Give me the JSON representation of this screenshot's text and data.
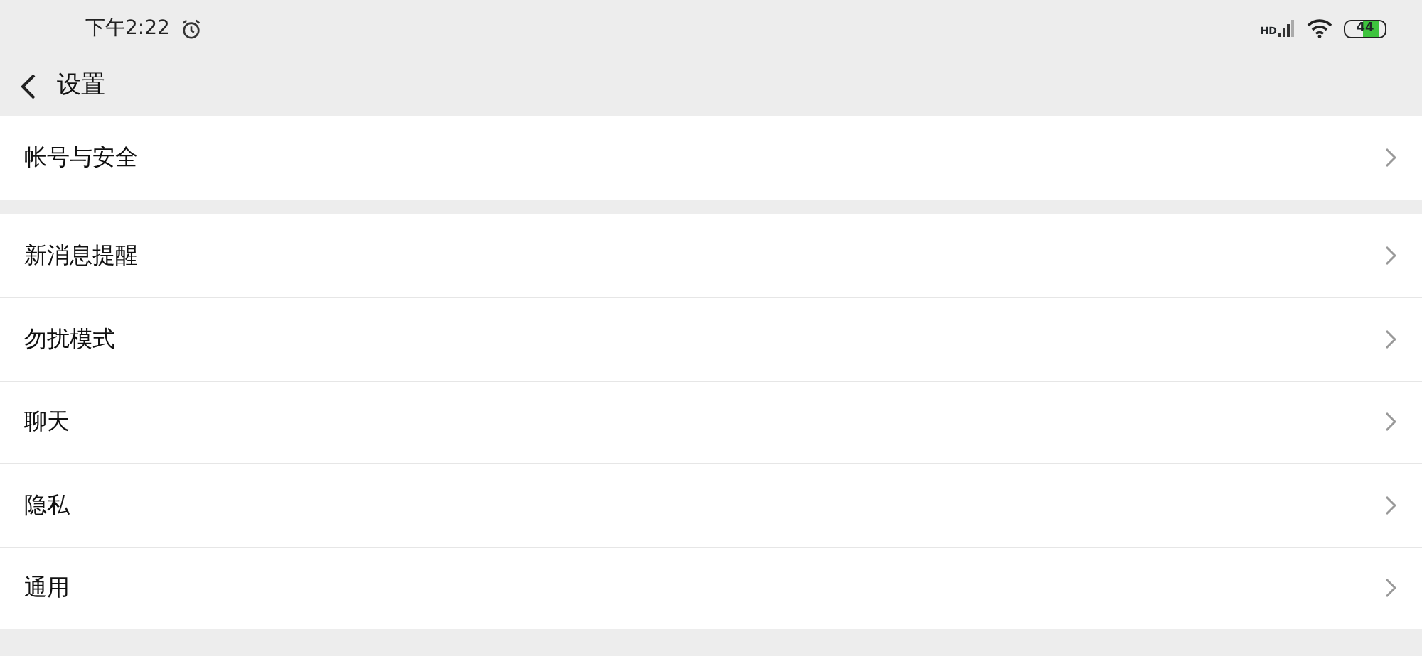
{
  "status_bar": {
    "time": "下午2:22",
    "network_label": "HD",
    "battery": "44"
  },
  "header": {
    "title": "设置"
  },
  "sections": [
    {
      "items": [
        {
          "label": "帐号与安全"
        }
      ]
    },
    {
      "items": [
        {
          "label": "新消息提醒"
        },
        {
          "label": "勿扰模式"
        },
        {
          "label": "聊天"
        },
        {
          "label": "隐私"
        },
        {
          "label": "通用"
        }
      ]
    }
  ]
}
